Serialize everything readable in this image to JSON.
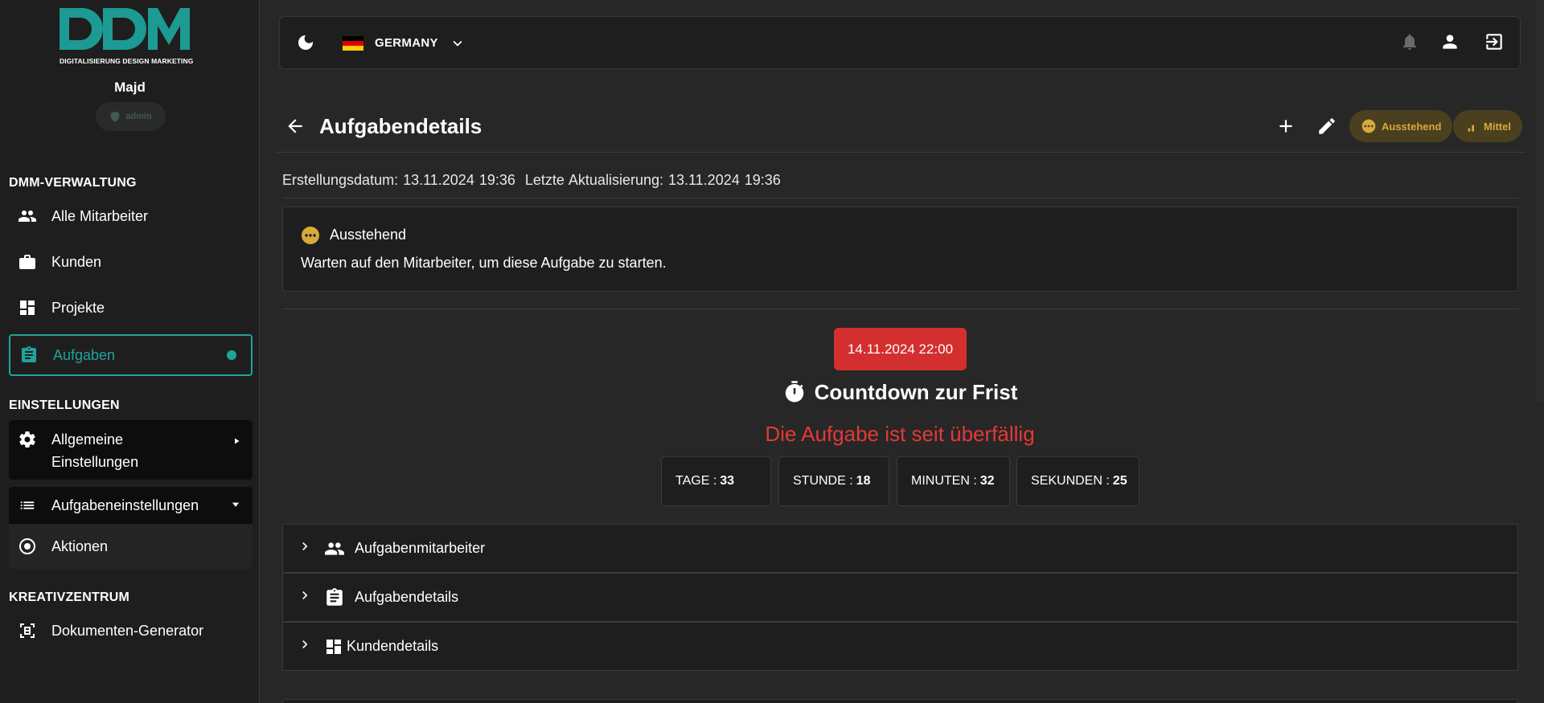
{
  "sidebar": {
    "logo_text": "DDM",
    "logo_subtitle": "DIGITALISIERUNG DESIGN MARKETING",
    "user_name": "Majd",
    "role": "admin",
    "sections": [
      {
        "title": "DMM-VERWALTUNG"
      },
      {
        "title": "EINSTELLUNGEN"
      },
      {
        "title": "KREATIVZENTRUM"
      }
    ],
    "items": [
      {
        "label": "Alle Mitarbeiter",
        "icon": "people-icon"
      },
      {
        "label": "Kunden",
        "icon": "briefcase-icon"
      },
      {
        "label": "Projekte",
        "icon": "dashboard-icon"
      },
      {
        "label": "Aufgaben",
        "icon": "clipboard-icon",
        "active": true
      },
      {
        "label": "Allgemeine Einstellungen",
        "label_line1": "Allgemeine",
        "label_line2": "Einstellungen",
        "icon": "gear-icon"
      },
      {
        "label": "Aufgabeneinstellungen",
        "icon": "list-icon"
      },
      {
        "label": "Aktionen",
        "icon": "radio-icon"
      },
      {
        "label": "Dokumenten-Generator",
        "icon": "document-scan-icon"
      }
    ]
  },
  "topbar": {
    "country": "GERMANY",
    "flag_colors": [
      "#000000",
      "#dd0000",
      "#ffce00"
    ]
  },
  "header": {
    "title": "Aufgabendetails",
    "status_pill": "Ausstehend",
    "priority_pill": "Mittel"
  },
  "dates": {
    "text": "Erstellungsdatum: 13.11.2024 19:36  Letzte Aktualisierung: 13.11.2024 19:36"
  },
  "status": {
    "label": "Ausstehend",
    "description": "Warten auf den Mitarbeiter, um diese Aufgabe zu starten."
  },
  "deadline": {
    "date": "14.11.2024 22:00",
    "title": "Countdown zur Frist",
    "overdue_text": "Die Aufgabe ist seit überfällig"
  },
  "countdown": [
    {
      "label": "TAGE :",
      "value": "33"
    },
    {
      "label": "STUNDE :",
      "value": "18"
    },
    {
      "label": "MINUTEN :",
      "value": "32"
    },
    {
      "label": "SEKUNDEN :",
      "value": "25"
    }
  ],
  "accordions": [
    {
      "label": "Aufgabenmitarbeiter",
      "icon": "people-icon"
    },
    {
      "label": "Aufgabendetails",
      "icon": "clipboard-icon"
    },
    {
      "label": "Kundendetails",
      "icon": "dashboard-icon"
    }
  ],
  "colors": {
    "accent": "#20a39a",
    "danger": "#d32f2f",
    "warning": "#d9a93a",
    "background": "#272727",
    "surface": "#1e1e1e"
  }
}
